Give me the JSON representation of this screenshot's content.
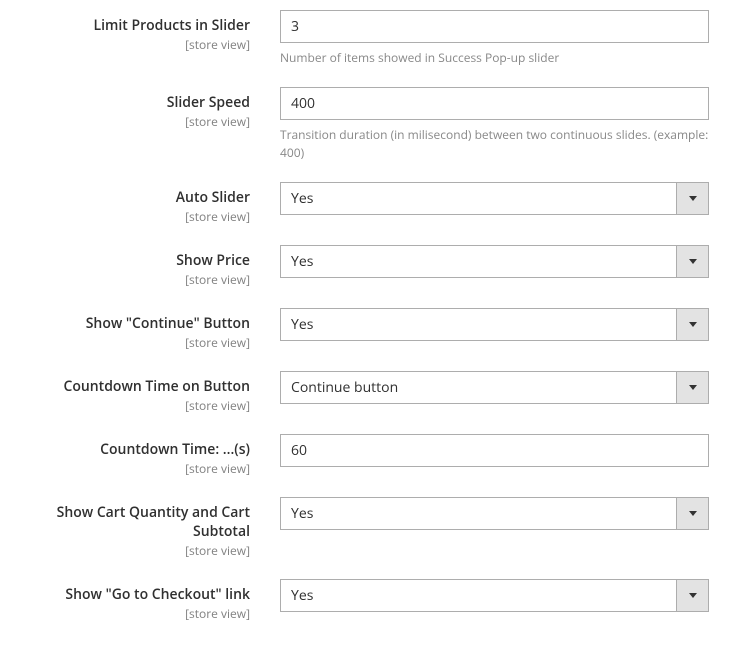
{
  "scope_label": "[store view]",
  "fields": {
    "limit_products": {
      "label": "Limit Products in Slider",
      "value": "3",
      "help": "Number of items showed in Success Pop-up slider"
    },
    "slider_speed": {
      "label": "Slider Speed",
      "value": "400",
      "help": "Transition duration (in milisecond) between two continuous slides. (example: 400)"
    },
    "auto_slider": {
      "label": "Auto Slider",
      "value": "Yes"
    },
    "show_price": {
      "label": "Show Price",
      "value": "Yes"
    },
    "show_continue": {
      "label": "Show \"Continue\" Button",
      "value": "Yes"
    },
    "countdown_on_button": {
      "label": "Countdown Time on Button",
      "value": "Continue button"
    },
    "countdown_time": {
      "label": "Countdown Time: ...(s)",
      "value": "60"
    },
    "show_cart_qty": {
      "label": "Show Cart Quantity and Cart Subtotal",
      "value": "Yes"
    },
    "show_checkout": {
      "label": "Show \"Go to Checkout\" link",
      "value": "Yes"
    }
  }
}
